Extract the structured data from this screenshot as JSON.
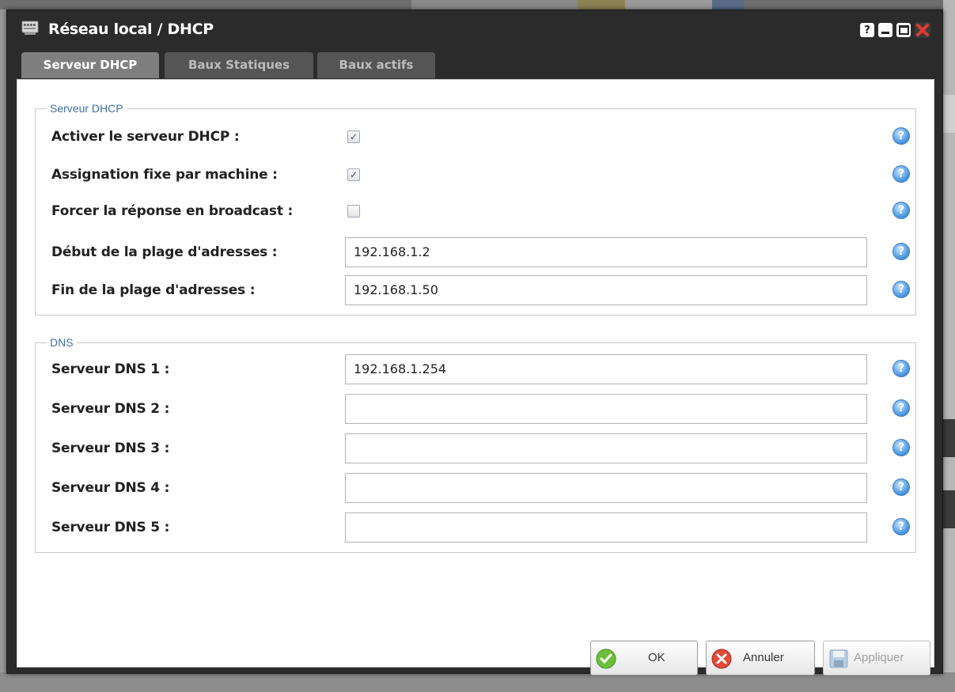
{
  "window": {
    "title": "Réseau local / DHCP",
    "help_label": "?"
  },
  "tabs": [
    {
      "label": "Serveur DHCP",
      "active": true
    },
    {
      "label": "Baux Statiques",
      "active": false
    },
    {
      "label": "Baux actifs",
      "active": false
    }
  ],
  "dhcp": {
    "legend": "Serveur DHCP",
    "enable": {
      "label": "Activer le serveur DHCP :",
      "checked": true
    },
    "fixed": {
      "label": "Assignation fixe par machine :",
      "checked": true
    },
    "broadcast": {
      "label": "Forcer la réponse en broadcast :",
      "checked": false
    },
    "range_start": {
      "label": "Début de la plage d'adresses :",
      "value": "192.168.1.2"
    },
    "range_end": {
      "label": "Fin de la plage d'adresses :",
      "value": "192.168.1.50"
    }
  },
  "dns": {
    "legend": "DNS",
    "servers": [
      {
        "label": "Serveur DNS 1 :",
        "value": "192.168.1.254"
      },
      {
        "label": "Serveur DNS 2 :",
        "value": ""
      },
      {
        "label": "Serveur DNS 3 :",
        "value": ""
      },
      {
        "label": "Serveur DNS 4 :",
        "value": ""
      },
      {
        "label": "Serveur DNS 5 :",
        "value": ""
      }
    ]
  },
  "help_glyph": "?",
  "check_glyph": "✓",
  "buttons": {
    "ok": "OK",
    "cancel": "Annuler",
    "apply": "Appliquer"
  },
  "colors": {
    "titlebar": "#2b2b2b",
    "tab_active": "#7f7f7f",
    "legend_text": "#3f6fa8",
    "help_icon": "#5aa2e6",
    "close_button": "#e03a2f"
  }
}
